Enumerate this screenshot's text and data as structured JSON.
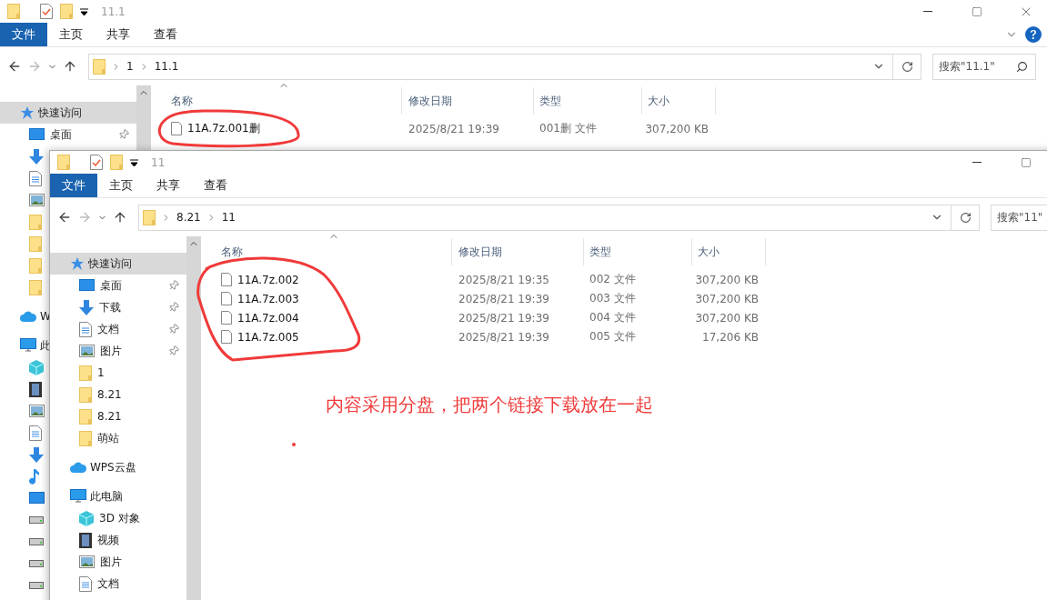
{
  "windows": [
    {
      "title": "11.1",
      "ribbon_tabs": [
        {
          "label": "文件",
          "selected": true
        },
        {
          "label": "主页",
          "selected": false
        },
        {
          "label": "共享",
          "selected": false
        },
        {
          "label": "查看",
          "selected": false
        }
      ],
      "breadcrumb": [
        "1",
        "11.1"
      ],
      "search": {
        "placeholder": "搜索\"11.1\""
      },
      "sidebar": [
        {
          "kind": "star",
          "label": "快速访问",
          "selected": true,
          "children": [
            {
              "kind": "desktop",
              "label": "桌面",
              "pinned": true,
              "selected": false
            },
            {
              "kind": "download",
              "pinned": false,
              "selected": false
            },
            {
              "kind": "document",
              "pinned": false,
              "selected": false
            },
            {
              "kind": "picture",
              "pinned": false,
              "selected": false
            },
            {
              "kind": "folder",
              "pinned": false,
              "selected": false
            },
            {
              "kind": "folder",
              "pinned": false,
              "selected": false
            },
            {
              "kind": "folder",
              "pinned": false,
              "selected": false
            },
            {
              "kind": "folder",
              "pinned": false,
              "selected": false
            }
          ]
        },
        {
          "kind": "cloud",
          "label": "W",
          "selected": false
        },
        {
          "kind": "pc",
          "label": "此",
          "selected": false,
          "children": [
            {
              "kind": "cube",
              "selected": false
            },
            {
              "kind": "video",
              "selected": false
            },
            {
              "kind": "picture",
              "selected": false
            },
            {
              "kind": "document",
              "selected": false
            },
            {
              "kind": "download",
              "selected": false
            },
            {
              "kind": "music",
              "selected": false
            },
            {
              "kind": "desktop",
              "selected": false
            },
            {
              "kind": "drive",
              "selected": false
            },
            {
              "kind": "drive",
              "selected": false
            },
            {
              "kind": "drive",
              "selected": false
            },
            {
              "kind": "drive",
              "selected": false
            }
          ]
        }
      ],
      "columns": [
        "名称",
        "修改日期",
        "类型",
        "大小"
      ],
      "rows": [
        {
          "name": "11A.7z.001删",
          "date": "2025/8/21 19:39",
          "type": "001删 文件",
          "size": "307,200 KB"
        }
      ]
    },
    {
      "title": "11",
      "ribbon_tabs": [
        {
          "label": "文件",
          "selected": true
        },
        {
          "label": "主页",
          "selected": false
        },
        {
          "label": "共享",
          "selected": false
        },
        {
          "label": "查看",
          "selected": false
        }
      ],
      "breadcrumb": [
        "8.21",
        "11"
      ],
      "search": {
        "placeholder": "搜索\"11\""
      },
      "sidebar": [
        {
          "kind": "star",
          "label": "快速访问",
          "selected": true,
          "children": [
            {
              "kind": "desktop",
              "label": "桌面",
              "pinned": true,
              "selected": false
            },
            {
              "kind": "download",
              "label": "下载",
              "pinned": true,
              "selected": false
            },
            {
              "kind": "document",
              "label": "文档",
              "pinned": true,
              "selected": false
            },
            {
              "kind": "picture",
              "label": "图片",
              "pinned": true,
              "selected": false
            },
            {
              "kind": "folder",
              "label": "1",
              "pinned": false,
              "selected": false
            },
            {
              "kind": "folder",
              "label": "8.21",
              "pinned": false,
              "selected": false
            },
            {
              "kind": "folder",
              "label": "8.21",
              "pinned": false,
              "selected": false
            },
            {
              "kind": "folder",
              "label": "萌站",
              "pinned": false,
              "selected": false
            }
          ]
        },
        {
          "kind": "cloud",
          "label": "WPS云盘",
          "selected": false
        },
        {
          "kind": "pc",
          "label": "此电脑",
          "selected": false,
          "children": [
            {
              "kind": "cube",
              "label": "3D 对象",
              "selected": false
            },
            {
              "kind": "video",
              "label": "视频",
              "selected": false
            },
            {
              "kind": "picture",
              "label": "图片",
              "selected": false
            },
            {
              "kind": "document",
              "label": "文档",
              "selected": false
            }
          ]
        }
      ],
      "columns": [
        "名称",
        "修改日期",
        "类型",
        "大小"
      ],
      "rows": [
        {
          "name": "11A.7z.002",
          "date": "2025/8/21 19:35",
          "type": "002 文件",
          "size": "307,200 KB"
        },
        {
          "name": "11A.7z.003",
          "date": "2025/8/21 19:39",
          "type": "003 文件",
          "size": "307,200 KB"
        },
        {
          "name": "11A.7z.004",
          "date": "2025/8/21 19:39",
          "type": "004 文件",
          "size": "307,200 KB"
        },
        {
          "name": "11A.7z.005",
          "date": "2025/8/21 19:39",
          "type": "005 文件",
          "size": "17,206 KB"
        }
      ]
    }
  ],
  "annotation": {
    "note": "内容采用分盘，把两个链接下载放在一起"
  }
}
